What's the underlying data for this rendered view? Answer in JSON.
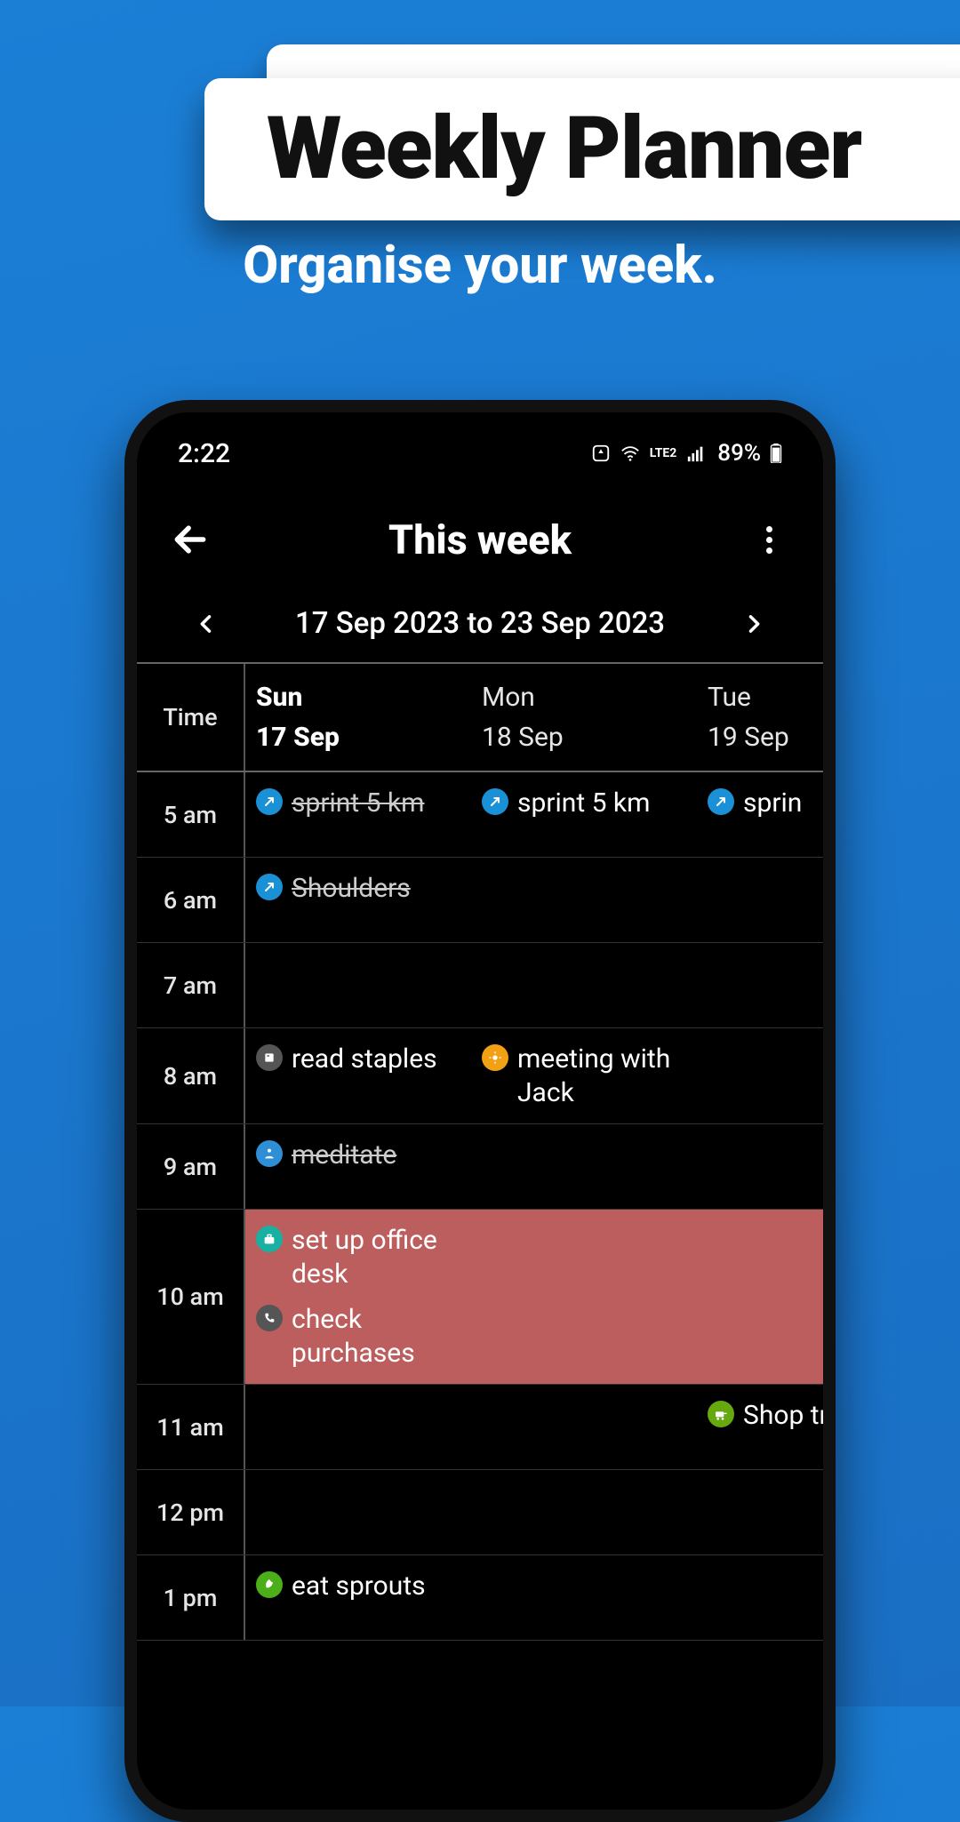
{
  "promo": {
    "title": "Weekly Planner",
    "subtitle": "Organise your week."
  },
  "status_bar": {
    "time": "2:22",
    "network_label": "LTE2",
    "battery_text": "89%"
  },
  "header": {
    "title": "This week"
  },
  "date_nav": {
    "range": "17 Sep 2023 to 23 Sep 2023"
  },
  "columns": {
    "time_label": "Time",
    "days": [
      {
        "dow": "Sun",
        "date": "17 Sep",
        "is_today": true
      },
      {
        "dow": "Mon",
        "date": "18 Sep",
        "is_today": false
      },
      {
        "dow": "Tue",
        "date": "19 Sep",
        "is_today": false
      }
    ]
  },
  "rows": [
    {
      "time": "5 am",
      "cells": [
        [
          {
            "text": "sprint 5 km",
            "icon": "run",
            "color": "#1a91d6",
            "done": true
          }
        ],
        [
          {
            "text": "sprint 5 km",
            "icon": "run",
            "color": "#1a91d6",
            "done": false
          }
        ],
        [
          {
            "text": "sprin",
            "icon": "run",
            "color": "#1a91d6",
            "done": false
          }
        ]
      ]
    },
    {
      "time": "6 am",
      "cells": [
        [
          {
            "text": "Shoulders",
            "icon": "run",
            "color": "#1a91d6",
            "done": true
          }
        ],
        [],
        []
      ]
    },
    {
      "time": "7 am",
      "cells": [
        [],
        [],
        []
      ]
    },
    {
      "time": "8 am",
      "cells": [
        [
          {
            "text": "read staples",
            "icon": "book",
            "color": "#555",
            "done": false
          }
        ],
        [
          {
            "text": "meeting with Jack",
            "icon": "sun",
            "color": "#f2a114",
            "done": false
          }
        ],
        []
      ]
    },
    {
      "time": "9 am",
      "cells": [
        [
          {
            "text": "meditate",
            "icon": "meditate",
            "color": "#2f8fd6",
            "done": true
          }
        ],
        [],
        []
      ]
    },
    {
      "time": "10 am",
      "highlight": true,
      "cells": [
        [
          {
            "text": "set up office desk",
            "icon": "briefcase",
            "color": "#17b0a1",
            "done": false
          },
          {
            "text": "check purchases",
            "icon": "phone",
            "color": "#555",
            "done": false
          }
        ],
        [],
        []
      ]
    },
    {
      "time": "11 am",
      "cells": [
        [],
        [],
        [
          {
            "text": "Shop trip",
            "icon": "cart",
            "color": "#66a80f",
            "done": false
          }
        ]
      ]
    },
    {
      "time": "12 pm",
      "cells": [
        [],
        [],
        []
      ]
    },
    {
      "time": "1 pm",
      "cells": [
        [
          {
            "text": "eat sprouts",
            "icon": "leaf",
            "color": "#4caf1a",
            "done": false
          }
        ],
        [],
        []
      ]
    }
  ],
  "icons": {
    "run": "↗",
    "book": "■",
    "sun": "✸",
    "meditate": "▲",
    "briefcase": "■",
    "phone": "✆",
    "cart": "🛒",
    "leaf": "❧"
  }
}
